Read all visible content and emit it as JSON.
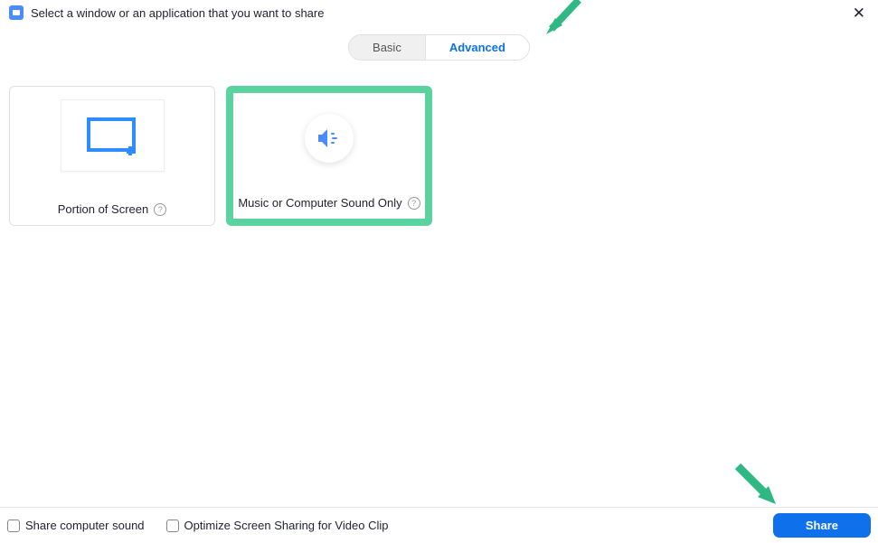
{
  "header": {
    "title": "Select a window or an application that you want to share"
  },
  "tabs": {
    "basic": "Basic",
    "advanced": "Advanced"
  },
  "options": {
    "portion": {
      "label": "Portion of Screen"
    },
    "music": {
      "label": "Music or Computer Sound Only"
    }
  },
  "footer": {
    "shareSound": "Share computer sound",
    "optimizeVideo": "Optimize Screen Sharing for Video Clip",
    "shareBtn": "Share"
  }
}
